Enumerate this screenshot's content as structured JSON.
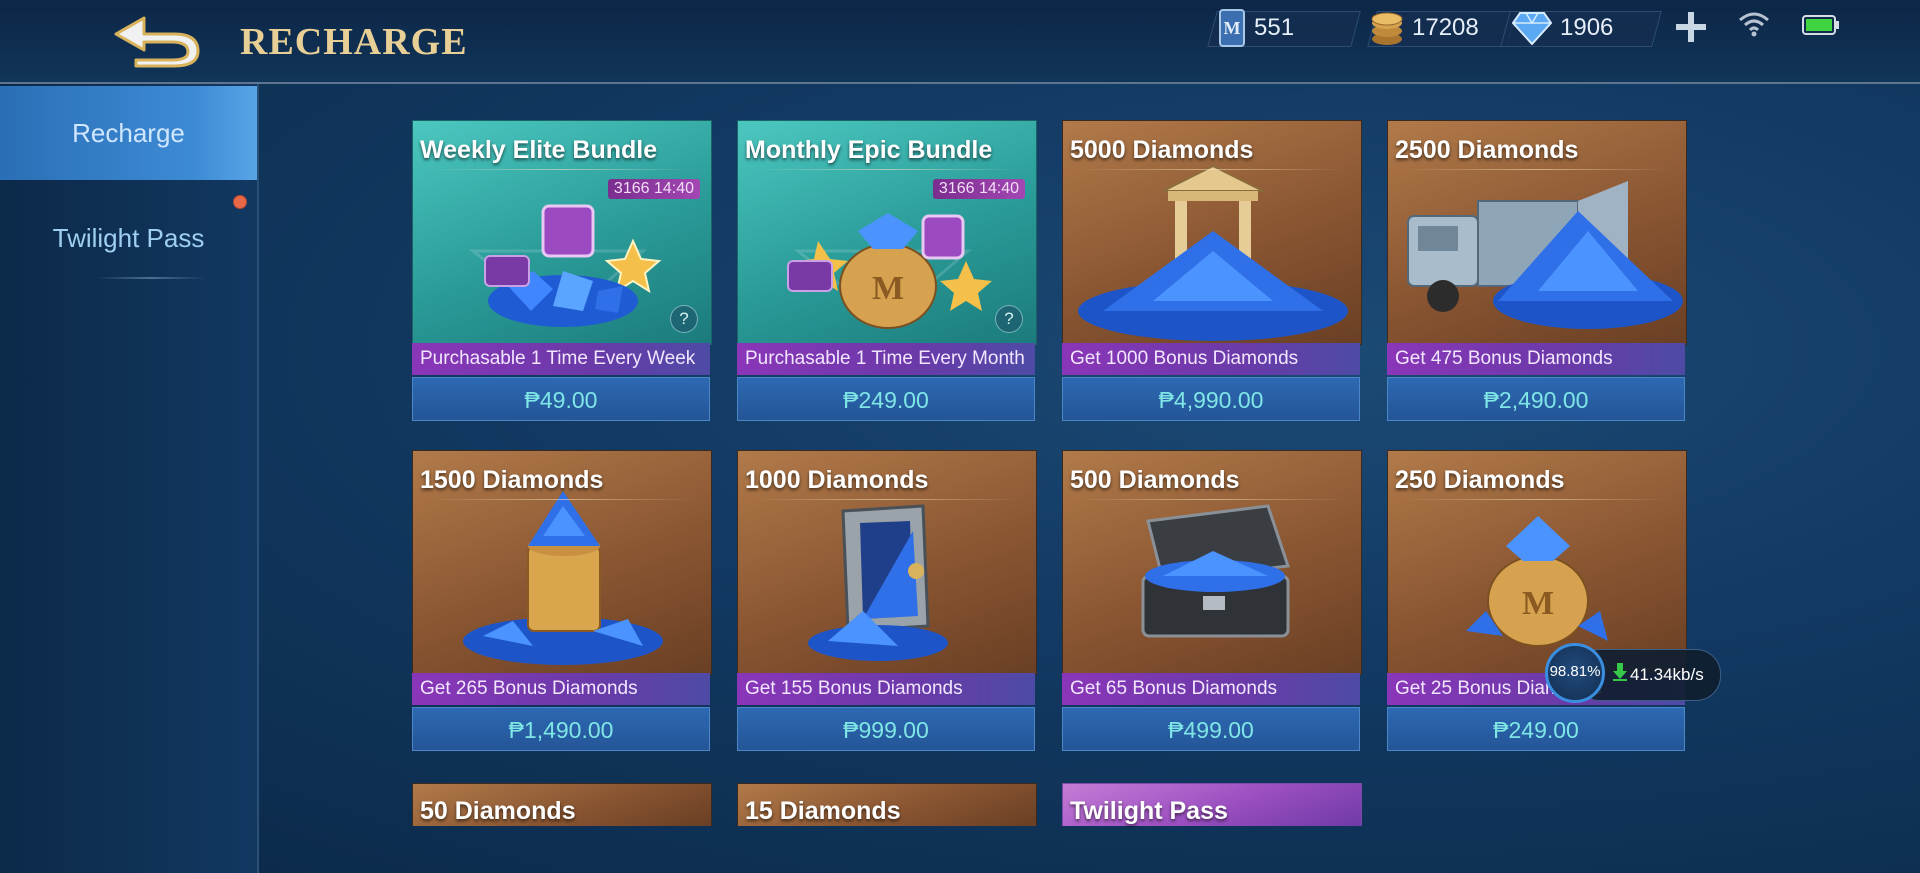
{
  "header": {
    "title": "RECHARGE",
    "currencies": [
      {
        "icon": "ticket-card-icon",
        "value": "551"
      },
      {
        "icon": "coin-stack-icon",
        "value": "17208"
      },
      {
        "icon": "diamond-icon",
        "value": "1906"
      }
    ]
  },
  "sidebar": {
    "items": [
      {
        "label": "Recharge",
        "active": true
      },
      {
        "label": "Twilight Pass",
        "active": false
      }
    ]
  },
  "cards": [
    {
      "title": "Weekly Elite Bundle",
      "timer": "3166 14:40",
      "bonus": "Purchasable 1 Time Every Week",
      "price": "₱49.00",
      "theme": "teal"
    },
    {
      "title": "Monthly Epic Bundle",
      "timer": "3166 14:40",
      "bonus": "Purchasable 1 Time Every Month",
      "price": "₱249.00",
      "theme": "teal"
    },
    {
      "title": "5000 Diamonds",
      "bonus": "Get 1000 Bonus Diamonds",
      "price": "₱4,990.00",
      "theme": "brown"
    },
    {
      "title": "2500 Diamonds",
      "bonus": "Get 475 Bonus Diamonds",
      "price": "₱2,490.00",
      "theme": "brown"
    },
    {
      "title": "1500 Diamonds",
      "bonus": "Get 265 Bonus Diamonds",
      "price": "₱1,490.00",
      "theme": "brown"
    },
    {
      "title": "1000 Diamonds",
      "bonus": "Get 155 Bonus Diamonds",
      "price": "₱999.00",
      "theme": "brown"
    },
    {
      "title": "500 Diamonds",
      "bonus": "Get 65 Bonus Diamonds",
      "price": "₱499.00",
      "theme": "brown"
    },
    {
      "title": "250 Diamonds",
      "bonus": "Get 25 Bonus Diamonds",
      "price": "₱249.00",
      "theme": "brown"
    },
    {
      "title": "50 Diamonds",
      "theme": "brown"
    },
    {
      "title": "15 Diamonds",
      "theme": "brown"
    },
    {
      "title": "Twilight Pass",
      "theme": "purple"
    }
  ],
  "download_overlay": {
    "percent": "98.81%",
    "speed": "41.34kb/s"
  },
  "colors": {
    "title_gold": "#e8cf96",
    "price_text": "#7fe6e6",
    "bonus_purple": "#8a36b8",
    "active_tab": "#2a6fb6"
  }
}
